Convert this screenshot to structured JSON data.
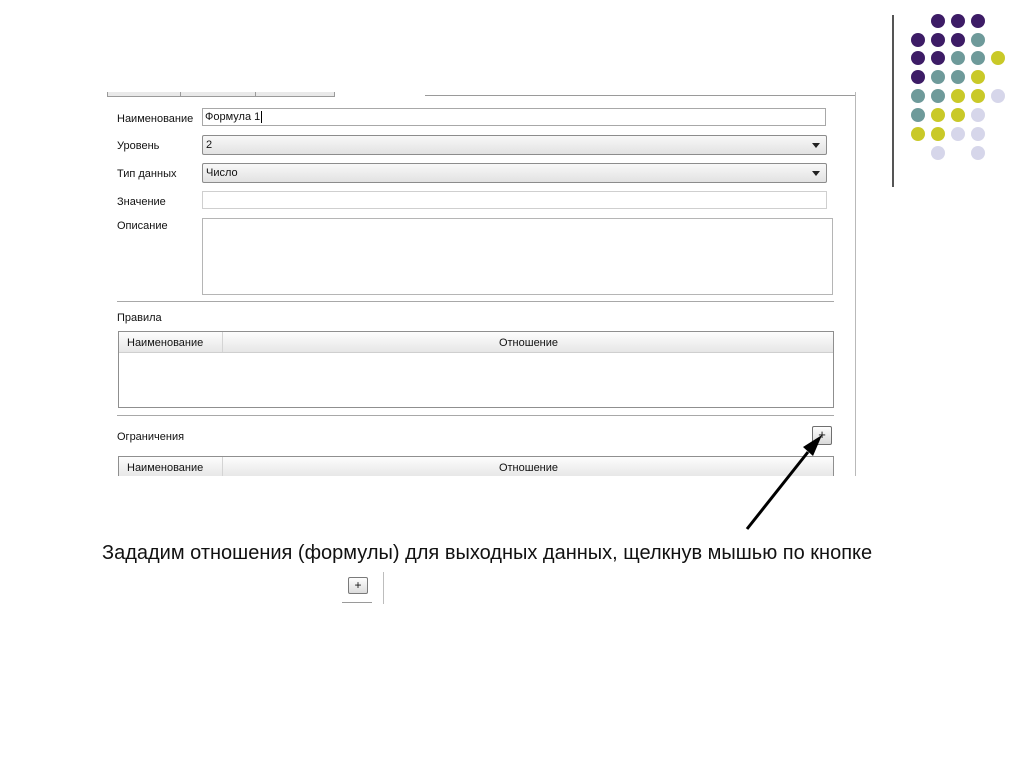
{
  "form": {
    "name_label": "Наименование",
    "name_value": "Формула 1",
    "level_label": "Уровень",
    "level_value": "2",
    "datatype_label": "Тип данных",
    "datatype_value": "Число",
    "value_label": "Значение",
    "value_value": "",
    "description_label": "Описание"
  },
  "rules": {
    "section_label": "Правила",
    "columns": [
      "Наименование",
      "Отношение"
    ]
  },
  "constraints": {
    "section_label": "Ограничения",
    "add_button": "+",
    "columns": [
      "Наименование",
      "Отношение"
    ]
  },
  "caption": {
    "text": "Зададим отношения (формулы) для выходных данных, щелкнув мышью по кнопке",
    "inline_button": "+"
  },
  "colors": {
    "dot_purple": "#3d1c66",
    "dot_teal": "#6e9a9a",
    "dot_olive": "#c9c928",
    "dot_lavender": "#d6d6ea"
  }
}
